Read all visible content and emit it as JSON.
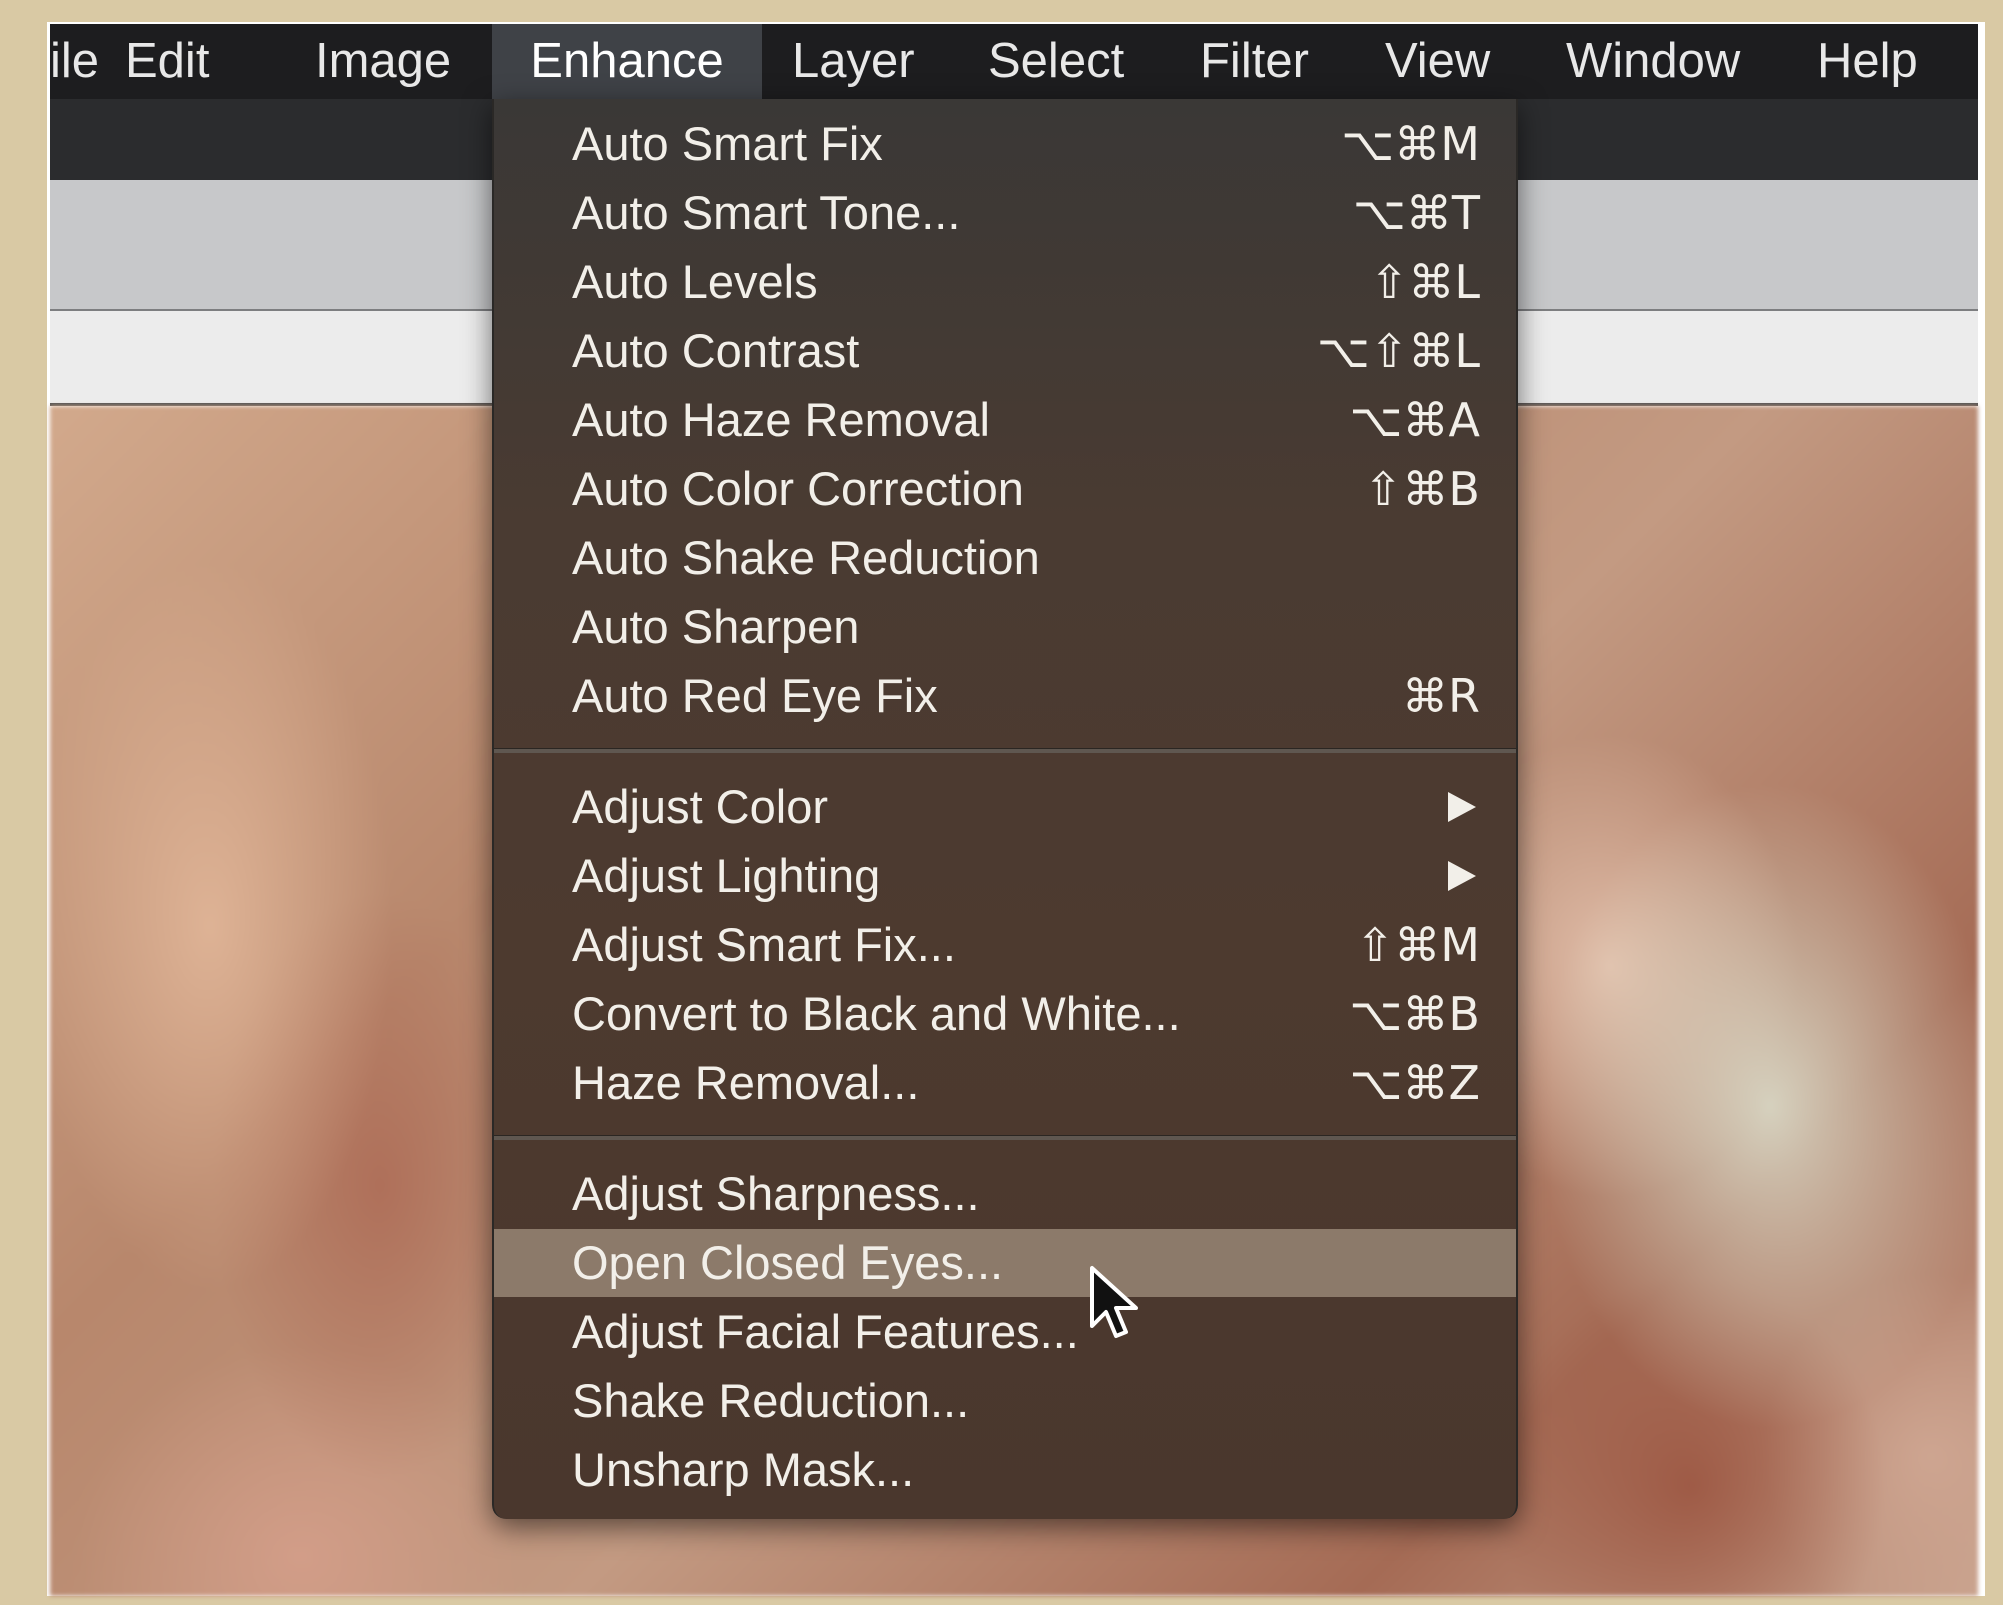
{
  "menubar": {
    "items": [
      {
        "label": "ile"
      },
      {
        "label": "Edit"
      },
      {
        "label": "Image"
      },
      {
        "label": "Enhance"
      },
      {
        "label": "Layer"
      },
      {
        "label": "Select"
      },
      {
        "label": "Filter"
      },
      {
        "label": "View"
      },
      {
        "label": "Window"
      },
      {
        "label": "Help"
      }
    ],
    "active_index": 3
  },
  "enhance_menu": {
    "groups": [
      [
        {
          "label": "Auto Smart Fix",
          "shortcut": "⌥⌘M"
        },
        {
          "label": "Auto Smart Tone...",
          "shortcut": "⌥⌘T"
        },
        {
          "label": "Auto Levels",
          "shortcut": "⇧⌘L"
        },
        {
          "label": "Auto Contrast",
          "shortcut": "⌥⇧⌘L"
        },
        {
          "label": "Auto Haze Removal",
          "shortcut": "⌥⌘A"
        },
        {
          "label": "Auto Color Correction",
          "shortcut": "⇧⌘B"
        },
        {
          "label": "Auto Shake Reduction",
          "shortcut": ""
        },
        {
          "label": "Auto Sharpen",
          "shortcut": ""
        },
        {
          "label": "Auto Red Eye Fix",
          "shortcut": "⌘R"
        }
      ],
      [
        {
          "label": "Adjust Color",
          "shortcut": "",
          "submenu": true
        },
        {
          "label": "Adjust Lighting",
          "shortcut": "",
          "submenu": true
        },
        {
          "label": "Adjust Smart Fix...",
          "shortcut": "⇧⌘M"
        },
        {
          "label": "Convert to Black and White...",
          "shortcut": "⌥⌘B"
        },
        {
          "label": "Haze Removal...",
          "shortcut": "⌥⌘Z"
        }
      ],
      [
        {
          "label": "Adjust Sharpness...",
          "shortcut": ""
        },
        {
          "label": "Open Closed Eyes...",
          "shortcut": "",
          "highlighted": true
        },
        {
          "label": "Adjust Facial Features...",
          "shortcut": ""
        },
        {
          "label": "Shake Reduction...",
          "shortcut": ""
        },
        {
          "label": "Unsharp Mask...",
          "shortcut": ""
        }
      ]
    ]
  },
  "colors": {
    "menubar_bg": "#1d1d1f",
    "menu_bg": "#4a3b32",
    "highlight": "#8c7a6a",
    "outer_border": "#d9c9a4"
  }
}
